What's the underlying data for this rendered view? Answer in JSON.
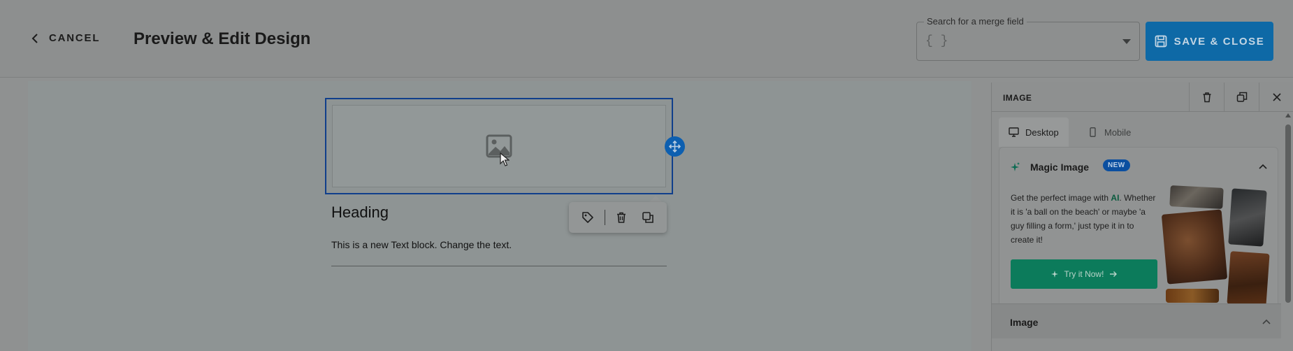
{
  "header": {
    "cancel_label": "CANCEL",
    "title": "Preview & Edit Design",
    "merge_field": {
      "label": "Search for a merge field",
      "placeholder": "{ }"
    },
    "save_label": "SAVE & CLOSE"
  },
  "canvas": {
    "heading": "Heading",
    "text": "This is a new Text block. Change the text."
  },
  "panel": {
    "title": "IMAGE",
    "tabs": [
      {
        "label": "Desktop",
        "icon": "monitor-icon"
      },
      {
        "label": "Mobile",
        "icon": "phone-icon"
      }
    ],
    "magic": {
      "title": "Magic Image",
      "badge": "NEW",
      "desc_prefix": "Get the perfect image with ",
      "desc_highlight": "AI",
      "desc_suffix": ". Whether it is 'a ball on the beach' or maybe 'a guy filling a form,' just type it in to create it!",
      "button": "Try it Now!"
    },
    "section_image": "Image"
  },
  "colors": {
    "save_button": "#0e69a6",
    "try_button": "#0c7b5b",
    "new_badge": "#0b4fa0",
    "selection": "#103f8b"
  }
}
